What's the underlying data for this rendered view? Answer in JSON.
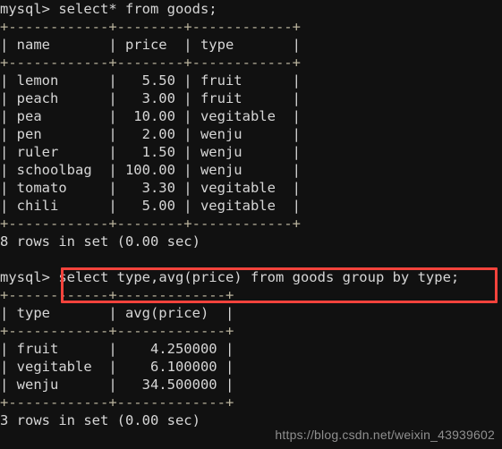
{
  "terminal": {
    "background_color": "#111111",
    "text_color": "#d6d6d6",
    "border_color": "#b9b39d",
    "prompt": "mysql>",
    "lines": [
      "mysql> select* from goods;",
      "+------------+--------+------------+",
      "| name       | price  | type       |",
      "+------------+--------+------------+",
      "| lemon      |   5.50 | fruit      |",
      "| peach      |   3.00 | fruit      |",
      "| pea        |  10.00 | vegitable  |",
      "| pen        |   2.00 | wenju      |",
      "| ruler      |   1.50 | wenju      |",
      "| schoolbag  | 100.00 | wenju      |",
      "| tomato     |   3.30 | vegitable  |",
      "| chili      |   5.00 | vegitable  |",
      "+------------+--------+------------+",
      "8 rows in set (0.00 sec)",
      "",
      "mysql> select type,avg(price) from goods group by type;",
      "+------------+-------------+",
      "| type       | avg(price)  |",
      "+------------+-------------+",
      "| fruit      |    4.250000 |",
      "| vegitable  |    6.100000 |",
      "| wenju      |   34.500000 |",
      "+------------+-------------+",
      "3 rows in set (0.00 sec)"
    ]
  },
  "query_1": {
    "prompt": "mysql>",
    "sql": " select* from goods;"
  },
  "table_1": {
    "top_rule": "+------------+--------+------------+",
    "header_rule": "+------------+--------+------------+",
    "bottom_rule": "+------------+--------+------------+",
    "header": "| name       | price  | type       |",
    "columns": [
      "name",
      "price",
      "type"
    ],
    "rows": [
      "| lemon      |   5.50 | fruit      |",
      "| peach      |   3.00 | fruit      |",
      "| pea        |  10.00 | vegitable  |",
      "| pen        |   2.00 | wenju      |",
      "| ruler      |   1.50 | wenju      |",
      "| schoolbag  | 100.00 | wenju      |",
      "| tomato     |   3.30 | vegitable  |",
      "| chili      |   5.00 | vegitable  |"
    ],
    "data": [
      {
        "name": "lemon",
        "price": "5.50",
        "type": "fruit"
      },
      {
        "name": "peach",
        "price": "3.00",
        "type": "fruit"
      },
      {
        "name": "pea",
        "price": "10.00",
        "type": "vegitable"
      },
      {
        "name": "pen",
        "price": "2.00",
        "type": "wenju"
      },
      {
        "name": "ruler",
        "price": "1.50",
        "type": "wenju"
      },
      {
        "name": "schoolbag",
        "price": "100.00",
        "type": "wenju"
      },
      {
        "name": "tomato",
        "price": "3.30",
        "type": "vegitable"
      },
      {
        "name": "chili",
        "price": "5.00",
        "type": "vegitable"
      }
    ],
    "status": "8 rows in set (0.00 sec)",
    "row_count": 8,
    "elapsed": "0.00 sec"
  },
  "query_2": {
    "prompt": "mysql>",
    "sql": " select type,avg(price) from goods group by type;",
    "highlight_color": "#f4433c",
    "highlighted": true
  },
  "table_2": {
    "top_rule": "+------------+-------------+",
    "header_rule": "+------------+-------------+",
    "bottom_rule": "+------------+-------------+",
    "header": "| type       | avg(price)  |",
    "columns": [
      "type",
      "avg(price)"
    ],
    "rows": [
      "| fruit      |    4.250000 |",
      "| vegitable  |    6.100000 |",
      "| wenju      |   34.500000 |"
    ],
    "data": [
      {
        "type": "fruit",
        "avg_price": "4.250000"
      },
      {
        "type": "vegitable",
        "avg_price": "6.100000"
      },
      {
        "type": "wenju",
        "avg_price": "34.500000"
      }
    ],
    "status": "3 rows in set (0.00 sec)",
    "row_count": 3,
    "elapsed": "0.00 sec"
  },
  "watermark": {
    "text": "https://blog.csdn.net/weixin_43939602",
    "color": "#8f8f8f"
  }
}
